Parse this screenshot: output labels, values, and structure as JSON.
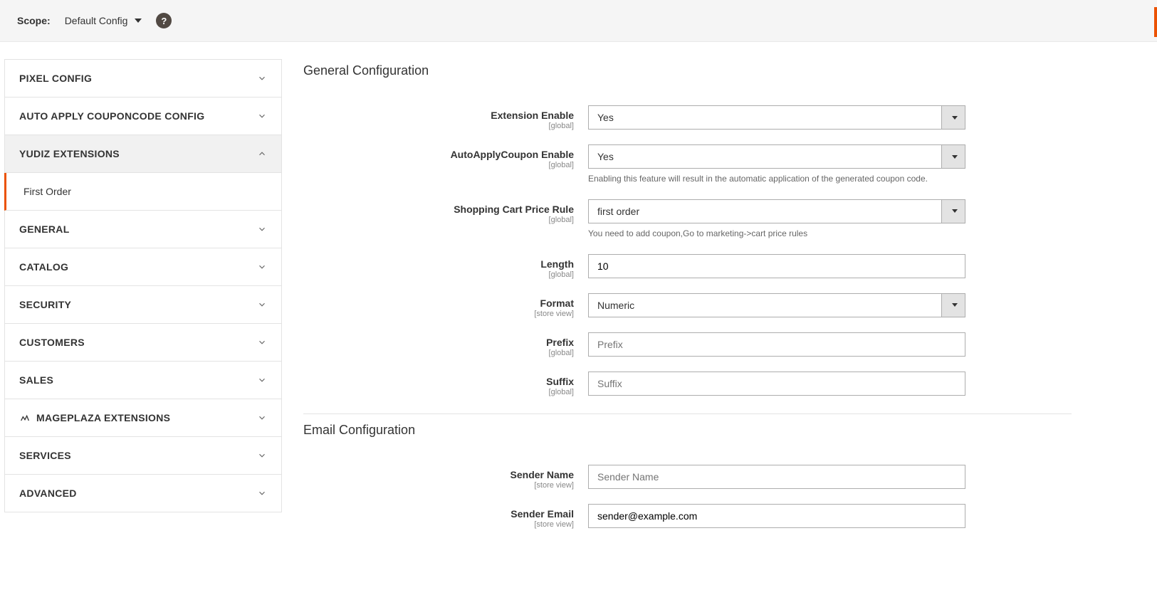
{
  "topbar": {
    "scope_label": "Scope:",
    "scope_value": "Default Config",
    "help_glyph": "?"
  },
  "sidebar": {
    "items": [
      {
        "label": "PIXEL CONFIG",
        "expanded": false,
        "hasIconPrefix": false
      },
      {
        "label": "AUTO APPLY COUPONCODE CONFIG",
        "expanded": false,
        "hasIconPrefix": false
      },
      {
        "label": "YUDIZ EXTENSIONS",
        "expanded": true,
        "hasIconPrefix": false
      },
      {
        "label": "First Order",
        "sub": true
      },
      {
        "label": "GENERAL",
        "expanded": false,
        "hasIconPrefix": false
      },
      {
        "label": "CATALOG",
        "expanded": false,
        "hasIconPrefix": false
      },
      {
        "label": "SECURITY",
        "expanded": false,
        "hasIconPrefix": false
      },
      {
        "label": "CUSTOMERS",
        "expanded": false,
        "hasIconPrefix": false
      },
      {
        "label": "SALES",
        "expanded": false,
        "hasIconPrefix": false
      },
      {
        "label": "MAGEPLAZA EXTENSIONS",
        "expanded": false,
        "hasIconPrefix": true
      },
      {
        "label": "SERVICES",
        "expanded": false,
        "hasIconPrefix": false
      },
      {
        "label": "ADVANCED",
        "expanded": false,
        "hasIconPrefix": false
      }
    ]
  },
  "sections": {
    "general": {
      "heading": "General Configuration",
      "fields": {
        "extension_enable": {
          "label": "Extension Enable",
          "scope": "[global]",
          "value": "Yes"
        },
        "autoapply_enable": {
          "label": "AutoApplyCoupon Enable",
          "scope": "[global]",
          "value": "Yes",
          "note": "Enabling this feature will result in the automatic application of the generated coupon code."
        },
        "price_rule": {
          "label": "Shopping Cart Price Rule",
          "scope": "[global]",
          "value": "first order",
          "note": "You need to add coupon,Go to marketing->cart price rules"
        },
        "length": {
          "label": "Length",
          "scope": "[global]",
          "value": "10"
        },
        "format": {
          "label": "Format",
          "scope": "[store view]",
          "value": "Numeric"
        },
        "prefix": {
          "label": "Prefix",
          "scope": "[global]",
          "placeholder": "Prefix",
          "value": ""
        },
        "suffix": {
          "label": "Suffix",
          "scope": "[global]",
          "placeholder": "Suffix",
          "value": ""
        }
      }
    },
    "email": {
      "heading": "Email Configuration",
      "fields": {
        "sender_name": {
          "label": "Sender Name",
          "scope": "[store view]",
          "placeholder": "Sender Name",
          "value": ""
        },
        "sender_email": {
          "label": "Sender Email",
          "scope": "[store view]",
          "value": "sender@example.com"
        }
      }
    }
  }
}
